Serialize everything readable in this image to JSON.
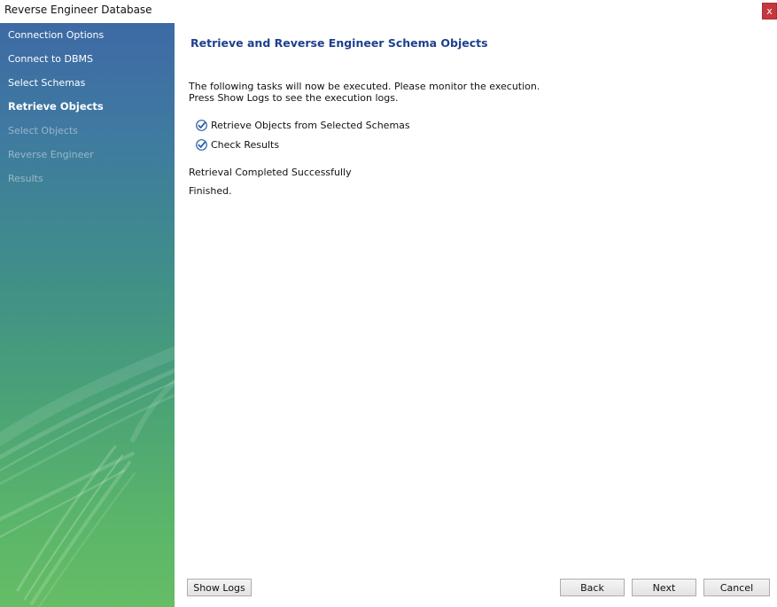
{
  "window": {
    "title": "Reverse Engineer Database",
    "close_label": "x"
  },
  "sidebar": {
    "items": [
      {
        "label": "Connection Options",
        "state": "done"
      },
      {
        "label": "Connect to DBMS",
        "state": "done"
      },
      {
        "label": "Select Schemas",
        "state": "done"
      },
      {
        "label": "Retrieve Objects",
        "state": "active"
      },
      {
        "label": "Select Objects",
        "state": "pending"
      },
      {
        "label": "Reverse Engineer",
        "state": "pending"
      },
      {
        "label": "Results",
        "state": "pending"
      }
    ]
  },
  "main": {
    "heading": "Retrieve and Reverse Engineer Schema Objects",
    "description_line1": "The following tasks will now be executed. Please monitor the execution.",
    "description_line2": "Press Show Logs to see the execution logs.",
    "tasks": [
      {
        "label": "Retrieve Objects from Selected Schemas",
        "status": "done"
      },
      {
        "label": "Check Results",
        "status": "done"
      }
    ],
    "status_message": "Retrieval Completed Successfully",
    "finished_message": "Finished."
  },
  "buttons": {
    "show_logs": "Show Logs",
    "back": "Back",
    "next": "Next",
    "cancel": "Cancel"
  },
  "colors": {
    "heading": "#1f3f8e",
    "sidebar_top": "#3d6aa4",
    "sidebar_bottom": "#66bd66",
    "close_button": "#c4373f",
    "check": "#2b5fa8"
  }
}
